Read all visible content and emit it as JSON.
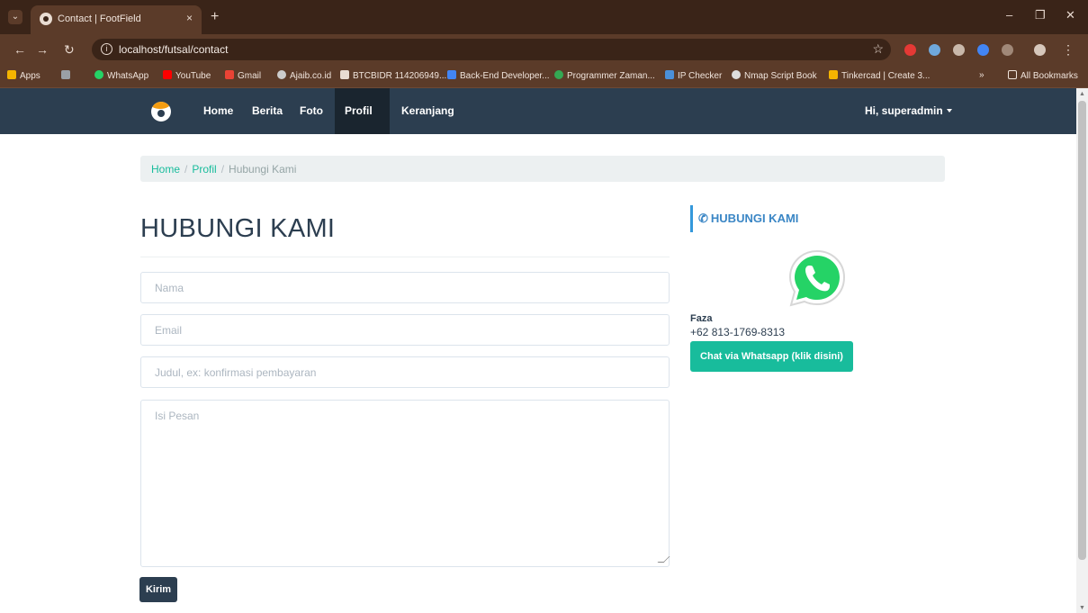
{
  "browser": {
    "tab_title": "Contact | FootField",
    "tab_close": "×",
    "new_tab": "+",
    "url": "localhost/futsal/contact",
    "bookmarks": [
      {
        "label": "Apps",
        "color": "#f4b400"
      },
      {
        "label": "",
        "color": "#9aa0a6"
      },
      {
        "label": "WhatsApp",
        "color": "#25d366"
      },
      {
        "label": "YouTube",
        "color": "#ff0000"
      },
      {
        "label": "Gmail",
        "color": "#ea4335"
      },
      {
        "label": "Ajaib.co.id",
        "color": "#cccccc"
      },
      {
        "label": "BTCBIDR 114206949...",
        "color": "#e9dcd2"
      },
      {
        "label": "Back-End Developer...",
        "color": "#4285f4"
      },
      {
        "label": "Programmer Zaman...",
        "color": "#34a853"
      },
      {
        "label": "IP Checker",
        "color": "#4a90d9"
      },
      {
        "label": "Nmap Script Book",
        "color": "#dddddd"
      },
      {
        "label": "Tinkercad | Create 3...",
        "color": "#f4b400"
      }
    ],
    "more_bookmarks": "»",
    "all_bookmarks": "All Bookmarks"
  },
  "navbar": {
    "items": [
      "Home",
      "Berita",
      "Foto",
      "Profil",
      "Keranjang"
    ],
    "user": "Hi, superadmin"
  },
  "breadcrumb": {
    "home": "Home",
    "profil": "Profil",
    "current": "Hubungi Kami",
    "separator": "/"
  },
  "page": {
    "title": "HUBUNGI KAMI"
  },
  "form": {
    "name_placeholder": "Nama",
    "email_placeholder": "Email",
    "subject_placeholder": "Judul, ex: konfirmasi pembayaran",
    "message_placeholder": "Isi Pesan",
    "submit_label": "Kirim"
  },
  "sidebar": {
    "heading": "HUBUNGI KAMI",
    "contact_name": "Faza",
    "contact_phone": "+62 813-1769-8313",
    "whatsapp_button": "Chat via Whatsapp (klik disini)"
  },
  "colors": {
    "navbar": "#2c3e50",
    "accent": "#18bc9c",
    "whatsapp": "#25d366"
  }
}
